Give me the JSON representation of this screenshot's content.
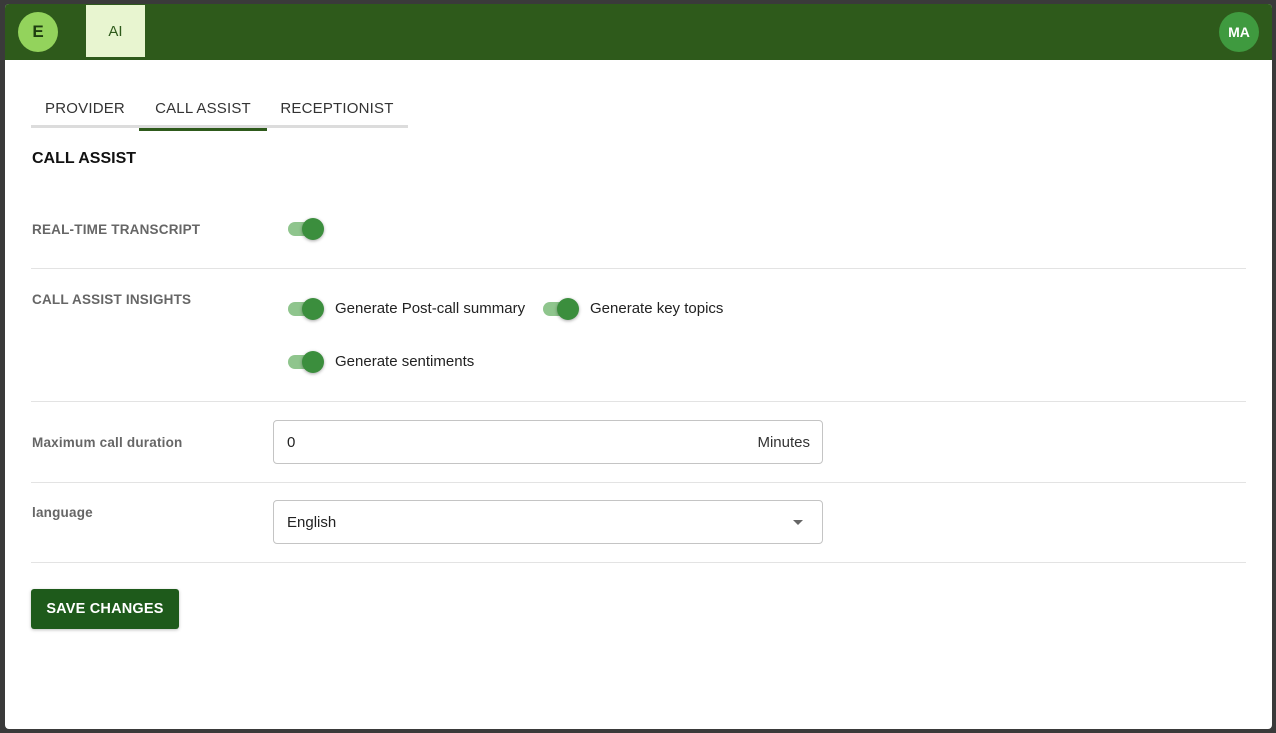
{
  "header": {
    "logo_letter": "E",
    "nav_ai": "AI",
    "avatar_initials": "MA"
  },
  "tabs": [
    {
      "label": "PROVIDER",
      "active": false
    },
    {
      "label": "CALL ASSIST",
      "active": true
    },
    {
      "label": "RECEPTIONIST",
      "active": false
    }
  ],
  "section": {
    "title": "CALL ASSIST"
  },
  "realtime_transcript": {
    "label": "REAL-TIME TRANSCRIPT",
    "enabled": true
  },
  "insights": {
    "label": "CALL ASSIST INSIGHTS",
    "post_call_summary": {
      "label": "Generate Post-call summary",
      "enabled": true
    },
    "key_topics": {
      "label": "Generate key topics",
      "enabled": true
    },
    "sentiments": {
      "label": "Generate sentiments",
      "enabled": true
    }
  },
  "max_duration": {
    "label": "Maximum call duration",
    "value": "0",
    "unit": "Minutes"
  },
  "language": {
    "label": "language",
    "selected": "English"
  },
  "actions": {
    "save_label": "SAVE CHANGES"
  },
  "colors": {
    "topbar": "#2e5a1b",
    "accent": "#3b8e3d",
    "button": "#1e5a1b"
  }
}
